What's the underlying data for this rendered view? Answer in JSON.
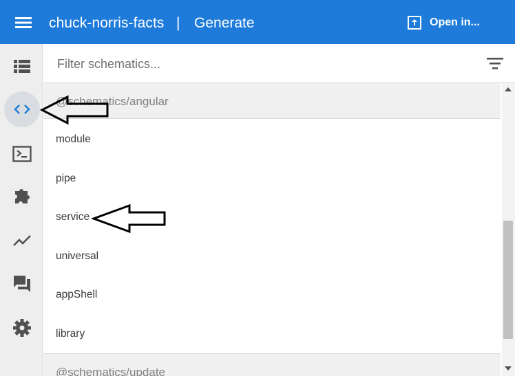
{
  "header": {
    "project": "chuck-norris-facts",
    "separator": "|",
    "page": "Generate",
    "open_label": "Open in..."
  },
  "rail": {
    "items": [
      "projects-list-icon",
      "code-icon",
      "terminal-icon",
      "extensions-icon",
      "analytics-icon",
      "forum-icon",
      "settings-icon"
    ],
    "active": "code-icon"
  },
  "filter": {
    "placeholder": "Filter schematics..."
  },
  "groups": [
    {
      "name": "@schematics/angular",
      "items": [
        "module",
        "pipe",
        "service",
        "universal",
        "appShell",
        "library"
      ]
    },
    {
      "name": "@schematics/update",
      "items": []
    }
  ],
  "colors": {
    "header_bg": "#1e7bd9",
    "rail_bg": "#eeeeee",
    "group_bg": "#f0f0f0",
    "active_icon": "#1e7bd9",
    "icon": "#505050"
  }
}
